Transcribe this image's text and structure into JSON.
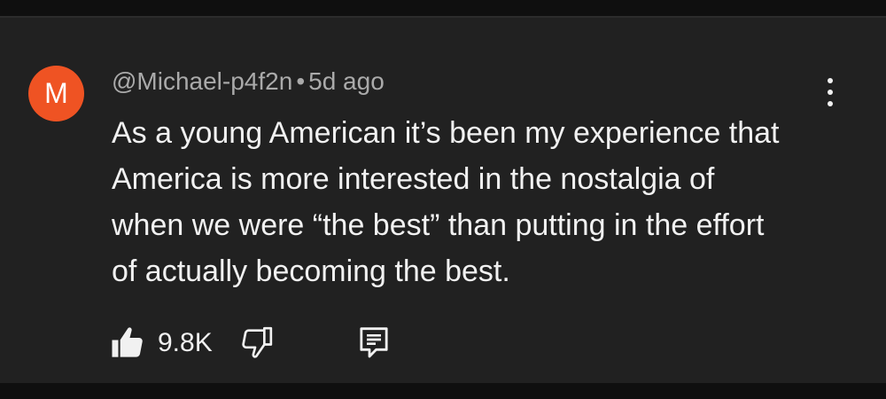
{
  "comment": {
    "avatar_initial": "M",
    "avatar_color": "#ef5323",
    "author": "@Michael-p4f2n",
    "separator": "•",
    "timestamp": "5d ago",
    "text_lines": [
      "As a young American it’s been my experience that",
      "America is more interested in the nostalgia of",
      "when we were “the best” than putting in the effort",
      "of actually becoming the best."
    ],
    "like_count": "9.8K"
  },
  "icons": {
    "menu": "more-vert-icon",
    "like": "thumb-up-icon",
    "dislike": "thumb-down-icon",
    "reply": "comment-reply-icon"
  },
  "colors": {
    "background": "#212121",
    "text": "#f1f1f1",
    "secondary_text": "#aaaaaa"
  }
}
